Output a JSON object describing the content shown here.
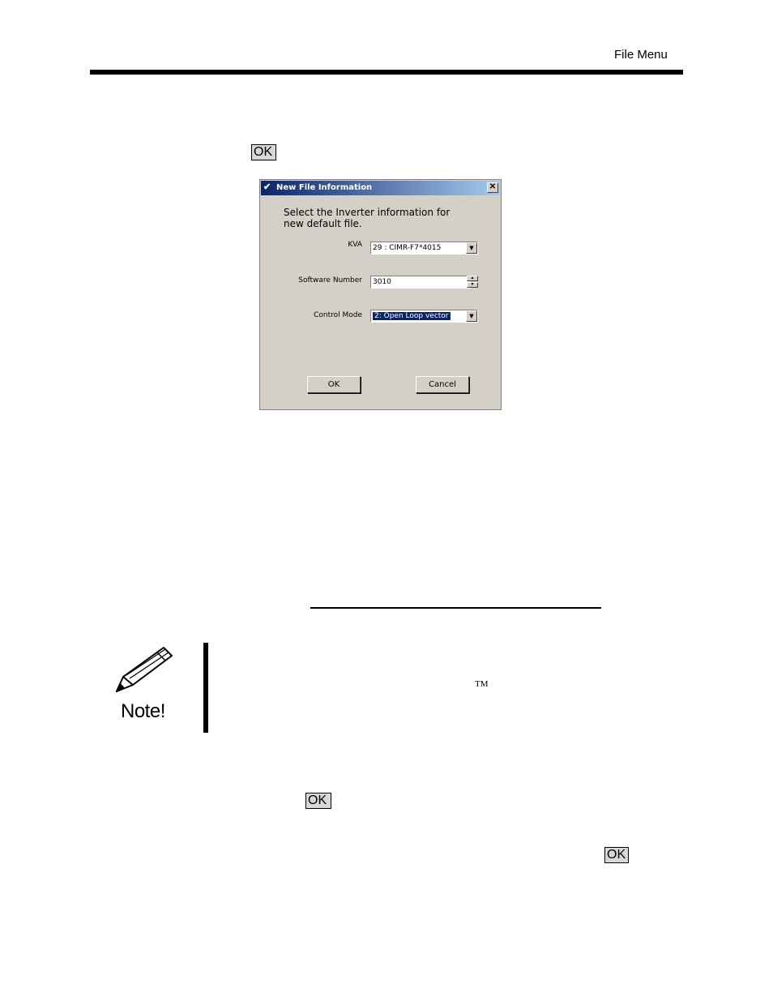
{
  "header": {
    "section_title": "File Menu"
  },
  "inline_buttons": {
    "ok_1": "OK",
    "ok_2": "OK",
    "ok_3": "OK"
  },
  "dialog": {
    "title": "New File Information",
    "prompt": "Select the Inverter information for new default file.",
    "kva_label": "KVA",
    "kva_value": "29 : CIMR-F7*4015",
    "software_label": "Software Number",
    "software_value": "3010",
    "control_label": "Control Mode",
    "control_value": "2: Open Loop vector",
    "ok_label": "OK",
    "cancel_label": "Cancel",
    "close_glyph": "✕"
  },
  "note": {
    "label": "Note!",
    "trademark": "TM"
  }
}
